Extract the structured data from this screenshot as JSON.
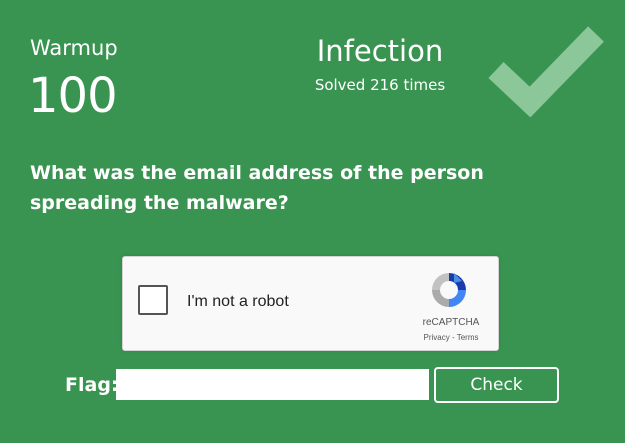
{
  "challenge": {
    "category": "Warmup",
    "points": "100",
    "title": "Infection",
    "solved": "Solved 216 times",
    "solved_status_icon": "check-icon",
    "question": "What was the email address of the person spreading the malware?"
  },
  "recaptcha": {
    "checkbox_label": "I'm not a robot",
    "brand": "reCAPTCHA",
    "privacy": "Privacy",
    "separator": " - ",
    "terms": "Terms"
  },
  "form": {
    "flag_label": "Flag:",
    "flag_value": "",
    "submit_label": "Check"
  },
  "colors": {
    "background": "#3a9451",
    "text": "#ffffff",
    "checkmark": "#8cc79a"
  }
}
